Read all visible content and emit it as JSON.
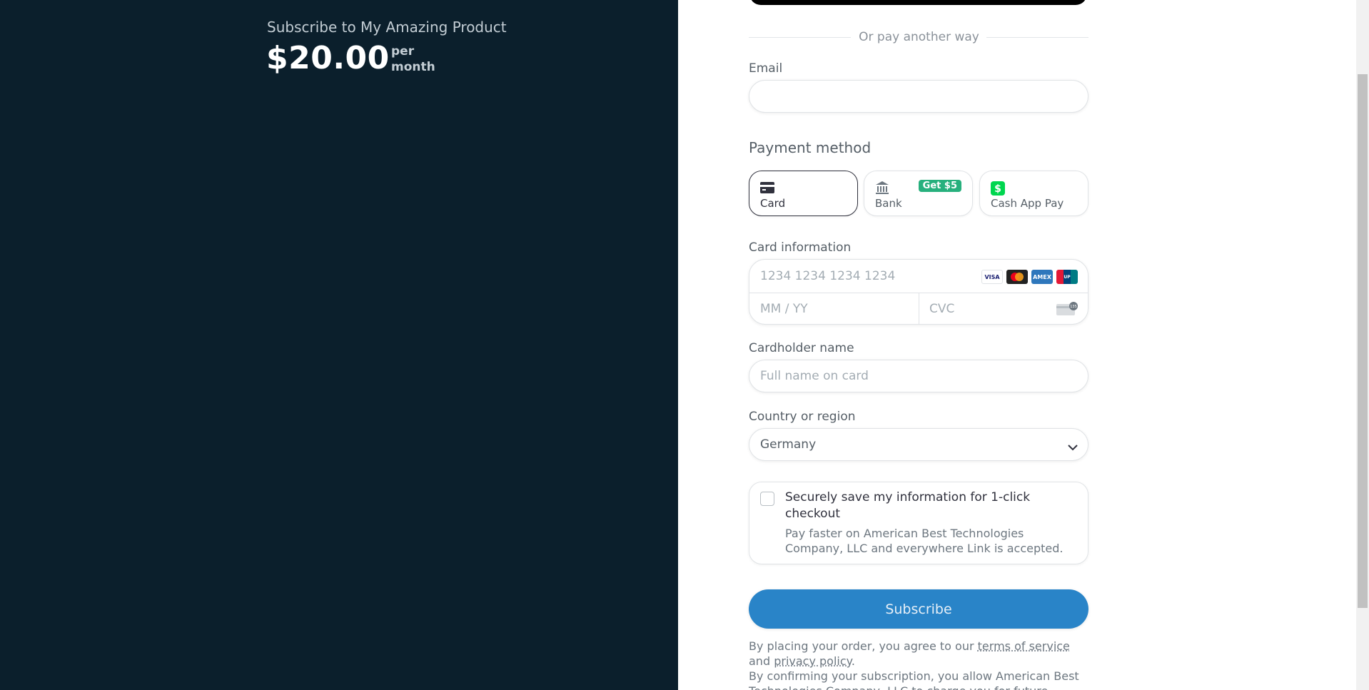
{
  "summary": {
    "product_name": "Subscribe to My Amazing Product",
    "price": "$20.00",
    "period_line1": "per",
    "period_line2": "month"
  },
  "divider": {
    "text": "Or pay another way"
  },
  "email": {
    "label": "Email",
    "value": "",
    "placeholder": ""
  },
  "payment": {
    "title": "Payment method",
    "methods": [
      {
        "label": "Card",
        "icon": "card-icon",
        "selected": true
      },
      {
        "label": "Bank",
        "icon": "bank-icon",
        "badge": "Get $5"
      },
      {
        "label": "Cash App Pay",
        "icon": "cashapp-icon"
      }
    ]
  },
  "card": {
    "label": "Card information",
    "number_placeholder": "1234 1234 1234 1234",
    "expiry_placeholder": "MM / YY",
    "cvc_placeholder": "CVC",
    "brands": [
      "VISA",
      "Mastercard",
      "Amex",
      "UnionPay"
    ]
  },
  "cardholder": {
    "label": "Cardholder name",
    "placeholder": "Full name on card"
  },
  "country": {
    "label": "Country or region",
    "value": "Germany"
  },
  "save": {
    "title": "Securely save my information for 1-click checkout",
    "description": "Pay faster on American Best Technologies Company, LLC and everywhere Link is accepted."
  },
  "subscribe_label": "Subscribe",
  "legal": {
    "line1_prefix": "By placing your order, you agree to our",
    "terms": "terms of service",
    "and": "and",
    "privacy": "privacy policy",
    "period": ".",
    "line2": "By confirming your subscription, you allow American Best Technologies Company, LLC to charge you for future"
  },
  "colors": {
    "sidebar_bg": "#0b1f2c",
    "accent": "#2984c8",
    "badge": "#27b07d"
  }
}
